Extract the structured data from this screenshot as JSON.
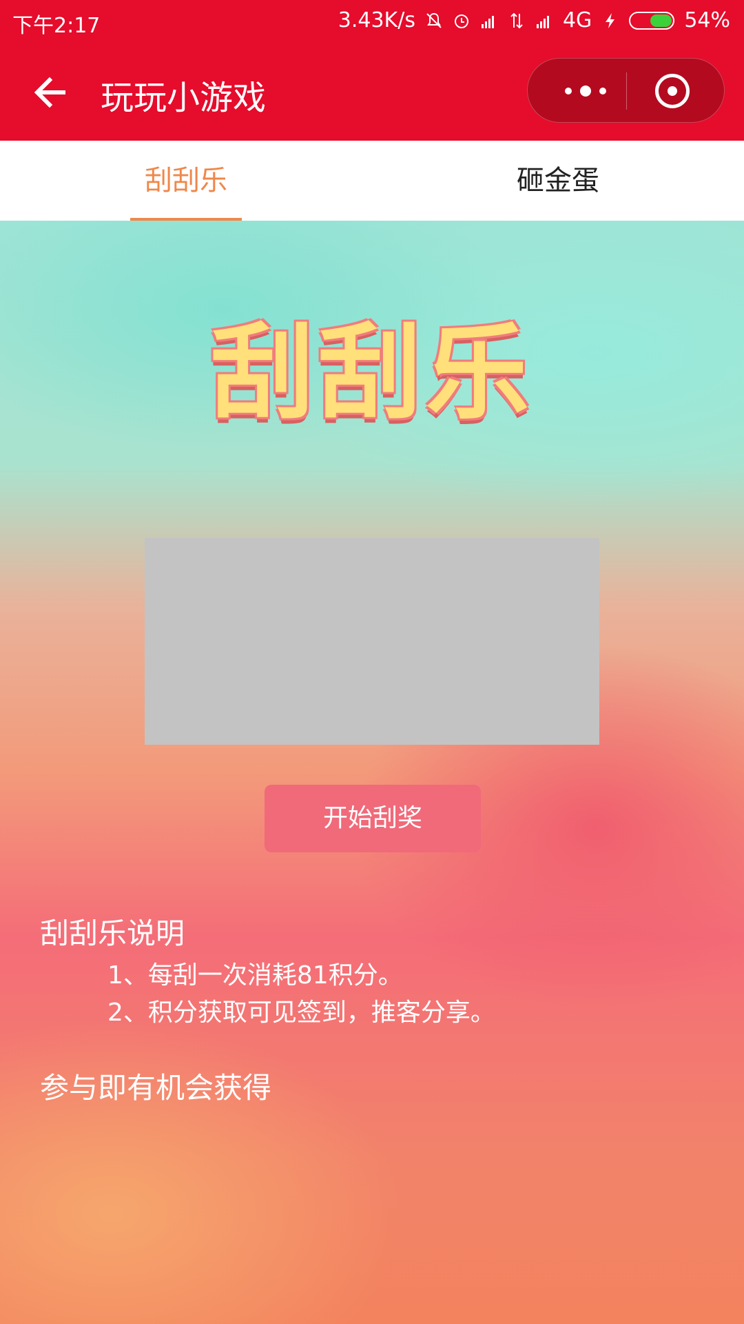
{
  "status_bar": {
    "time": "下午2:17",
    "speed": "3.43K/s",
    "network": "4G",
    "battery": "54%",
    "battery_level": 0.54
  },
  "nav": {
    "title": "玩玩小游戏"
  },
  "tabs": [
    {
      "label": "刮刮乐",
      "active": true
    },
    {
      "label": "砸金蛋",
      "active": false
    }
  ],
  "game": {
    "title": "刮刮乐",
    "start_button": "开始刮奖",
    "rules_title": "刮刮乐说明",
    "rules": [
      "1、每刮一次消耗81积分。",
      "2、积分获取可见签到，推客分享。"
    ],
    "prize_title": "参与即有机会获得"
  },
  "colors": {
    "brand_red": "#e50c2c",
    "tab_active": "#f0874a",
    "button": "#f06a7a",
    "scratch_cover": "#c3c3c3"
  }
}
